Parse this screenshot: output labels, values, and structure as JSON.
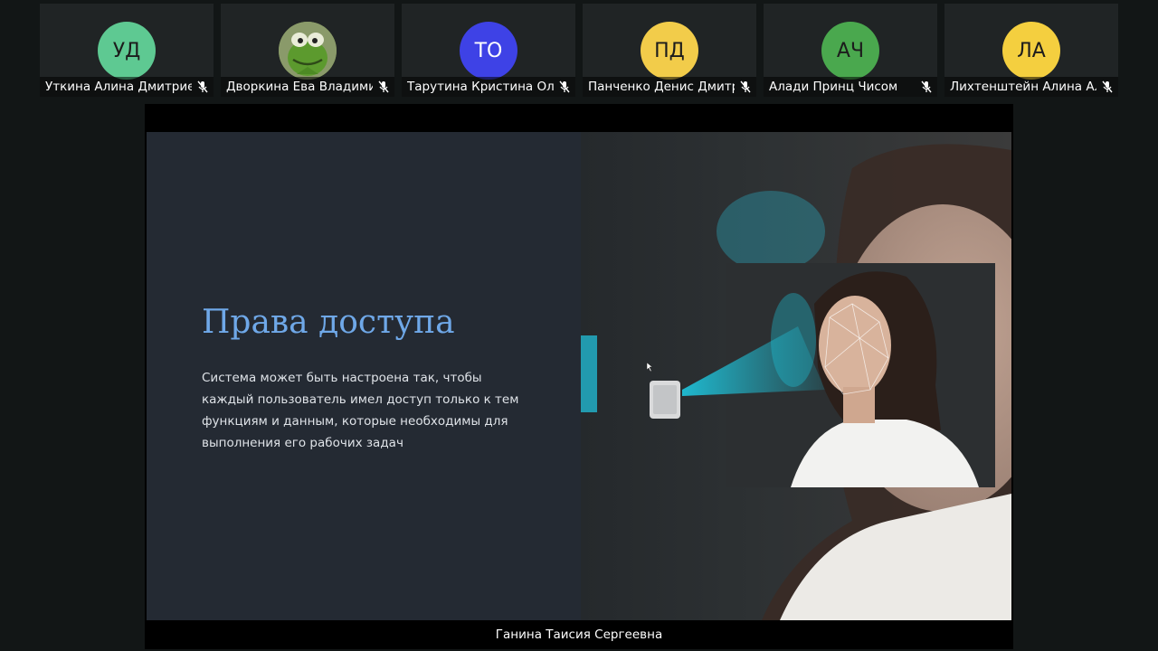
{
  "participants": [
    {
      "name": "Уткина Алина Дмитриева",
      "initials": "УД",
      "avatar_color": "#5ec992",
      "mic": "muted"
    },
    {
      "name": "Дворкина Ева Владимировна",
      "initials": "",
      "avatar_image": "kermit-frog-photo",
      "mic": "muted"
    },
    {
      "name": "Тарутина Кристина Олеговна",
      "initials": "ТО",
      "avatar_color": "#3e42e6",
      "mic": "muted"
    },
    {
      "name": "Панченко Денис Дмитриевич",
      "initials": "ПД",
      "avatar_color": "#f2cc4a",
      "mic": "muted"
    },
    {
      "name": "Алади Принц Чисом",
      "initials": "АЧ",
      "avatar_color": "#4aa84e",
      "mic": "muted"
    },
    {
      "name": "Лихтенштейн Алина Алексеевна",
      "initials": "ЛА",
      "avatar_color": "#f4cf3f",
      "mic": "muted"
    }
  ],
  "shared_screen": {
    "slide": {
      "title": "Права доступа",
      "body": "Система может быть настроена так, чтобы каждый пользователь имел доступ только к тем функциям и данным, которые необходимы для выполнения его рабочих задач",
      "image": "face-recognition-scan-photo",
      "title_color": "#6fa8e8"
    },
    "speaker_name": "Ганина Таисия Сергеевна"
  }
}
